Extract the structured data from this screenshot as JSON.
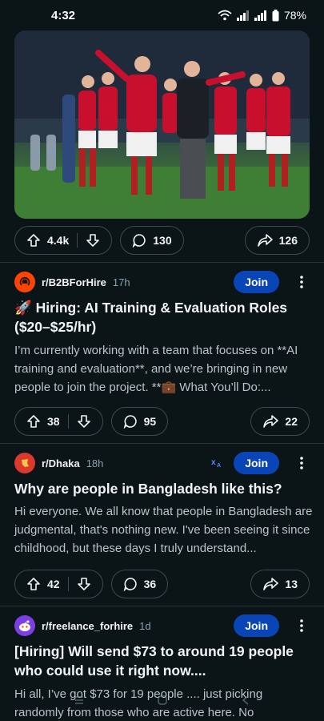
{
  "status": {
    "time": "4:32",
    "battery": "78%"
  },
  "feed": {
    "post1": {
      "upvotes": "4.4k",
      "comments": "130",
      "shares": "126"
    },
    "post2": {
      "subreddit": "r/B2BForHire",
      "age": "17h",
      "join_label": "Join",
      "title": "🚀 Hiring: AI Training & Evaluation Roles ($20–$25/hr)",
      "body": "I’m currently working with a team that focuses on **AI training and evaluation**, and we’re bringing in new people to join the project. **💼 What You’ll Do:...",
      "upvotes": "38",
      "comments": "95",
      "shares": "22"
    },
    "post3": {
      "subreddit": "r/Dhaka",
      "age": "18h",
      "join_label": "Join",
      "title": "Why are people in Bangladesh like this?",
      "body": "Hi everyone. We all know that people in Bangladesh are judgmental, that's nothing new. I've been seeing it since childhood, but these days I truly understand...",
      "upvotes": "42",
      "comments": "36",
      "shares": "13"
    },
    "post4": {
      "subreddit": "r/freelance_forhire",
      "age": "1d",
      "join_label": "Join",
      "title": "[Hiring] Will send $73 to around 19 people who could use it right now....",
      "body": "Hi all, I’ve got $73 for 19 people .... just picking randomly from those who are active here. No"
    }
  },
  "colors": {
    "background": "#0b1416",
    "join": "#0a45b8",
    "muted": "#8ba2ad"
  },
  "icons": [
    "wifi-icon",
    "signal-icon",
    "battery-icon",
    "upvote-icon",
    "downvote-icon",
    "comment-icon",
    "share-icon",
    "more-icon",
    "translate-icon"
  ]
}
